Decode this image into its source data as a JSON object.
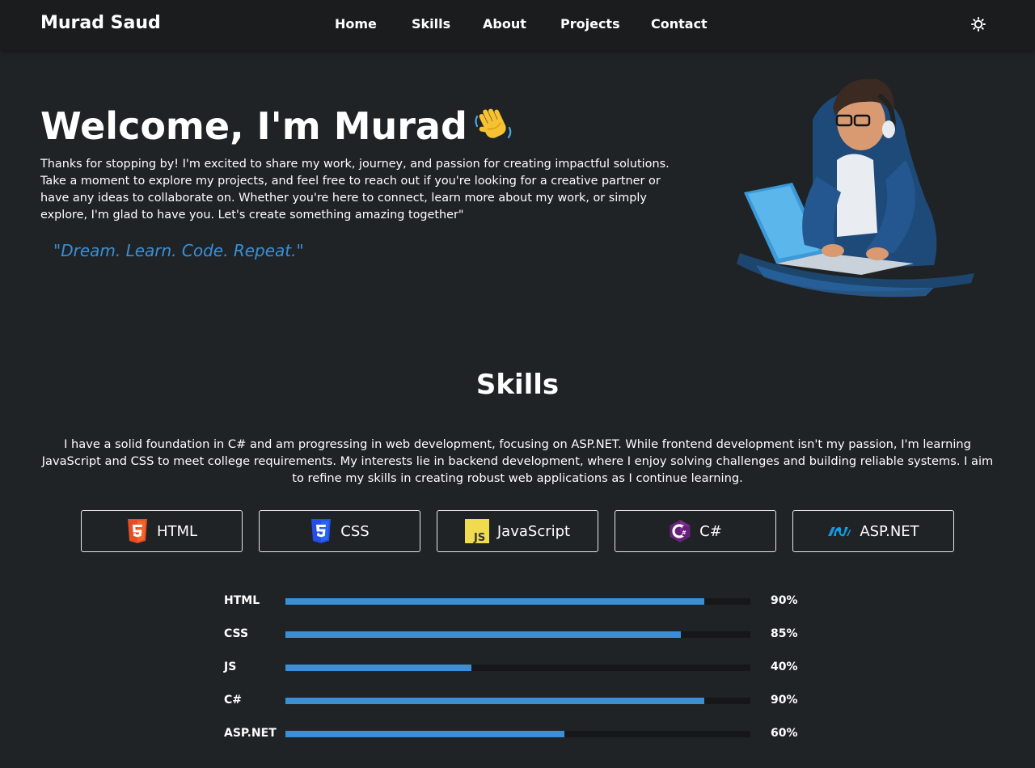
{
  "navbar": {
    "brand": "Murad Saud",
    "links": [
      "Home",
      "Skills",
      "About",
      "Projects",
      "Contact"
    ],
    "theme_icon": "sun-icon"
  },
  "hero": {
    "title": "Welcome, I'm Murad",
    "title_icon": "waving-hand-icon",
    "text": "Thanks for stopping by! I'm excited to share my work, journey, and passion for creating impactful solutions. Take a moment to explore my projects, and feel free to reach out if you're looking for a creative partner or have any ideas to collaborate on. Whether you're here to connect, learn more about my work, or simply explore, I'm glad to have you. Let's create something amazing together\"",
    "quote": "\"Dream. Learn. Code. Repeat.\"",
    "illustration": "developer-illustration"
  },
  "skills": {
    "title": "Skills",
    "description": "I have a solid foundation in C# and am progressing in web development, focusing on ASP.NET. While frontend development isn't my passion, I'm learning JavaScript and CSS to meet college requirements. My interests lie in backend development, where I enjoy solving challenges and building reliable systems. I aim to refine my skills in creating robust web applications as I continue learning.",
    "cards": [
      {
        "label": "HTML",
        "icon": "html5-icon"
      },
      {
        "label": "CSS",
        "icon": "css3-icon"
      },
      {
        "label": "JavaScript",
        "icon": "javascript-icon"
      },
      {
        "label": "C#",
        "icon": "csharp-icon"
      },
      {
        "label": "ASP.NET",
        "icon": "dotnet-icon"
      }
    ],
    "bars": [
      {
        "label": "HTML",
        "percent": 90,
        "percent_text": "90%"
      },
      {
        "label": "CSS",
        "percent": 85,
        "percent_text": "85%"
      },
      {
        "label": "JS",
        "percent": 40,
        "percent_text": "40%"
      },
      {
        "label": "C#",
        "percent": 90,
        "percent_text": "90%"
      },
      {
        "label": "ASP.NET",
        "percent": 60,
        "percent_text": "60%"
      }
    ]
  },
  "colors": {
    "background": "#1f2326",
    "navbar": "#1a1c1e",
    "accent": "#3a8fd6",
    "bar_track": "#151718"
  }
}
